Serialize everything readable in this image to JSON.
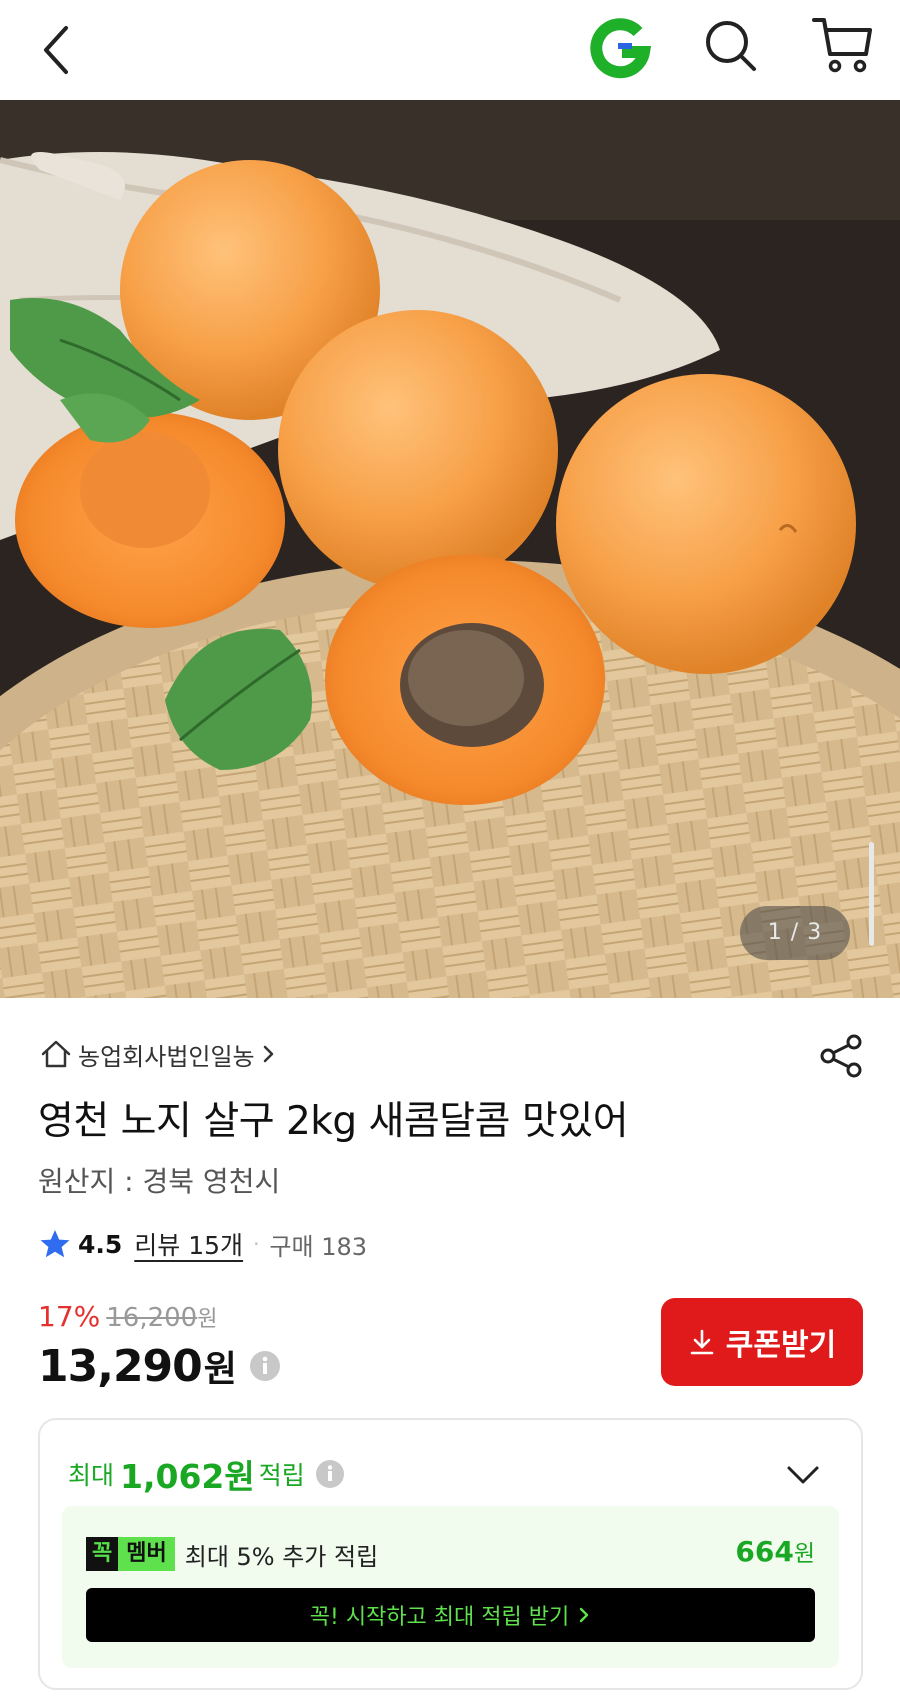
{
  "header": {
    "back_icon": "chevron-left-icon",
    "logo_icon": "g-logo-icon",
    "search_icon": "search-icon",
    "cart_icon": "cart-icon",
    "brand_color": "#1aa824"
  },
  "gallery": {
    "counter": "1 / 3"
  },
  "seller": {
    "name": "농업회사법인일농",
    "icon": "house-icon"
  },
  "product": {
    "title": "영천 노지 살구 2kg 새콤달콤 맛있어",
    "origin": "원산지 : 경북 영천시"
  },
  "rating": {
    "score": "4.5",
    "review": "리뷰 15개",
    "separator": "·",
    "purchase": "구매 183"
  },
  "price": {
    "discount_rate": "17%",
    "original": "16,200",
    "original_unit": "원",
    "sale": "13,290",
    "sale_unit": "원",
    "discount_color": "#e53030"
  },
  "coupon": {
    "label": "쿠폰받기",
    "color": "#e01a1a"
  },
  "reward": {
    "prefix": "최대",
    "amount": "1,062원",
    "suffix": "적립"
  },
  "membership": {
    "badge_left": "꼭",
    "badge_right": "멤버",
    "text": "최대 5% 추가 적립",
    "amount": "664",
    "amount_unit": "원",
    "cta": "꼭! 시작하고 최대 적립 받기"
  }
}
